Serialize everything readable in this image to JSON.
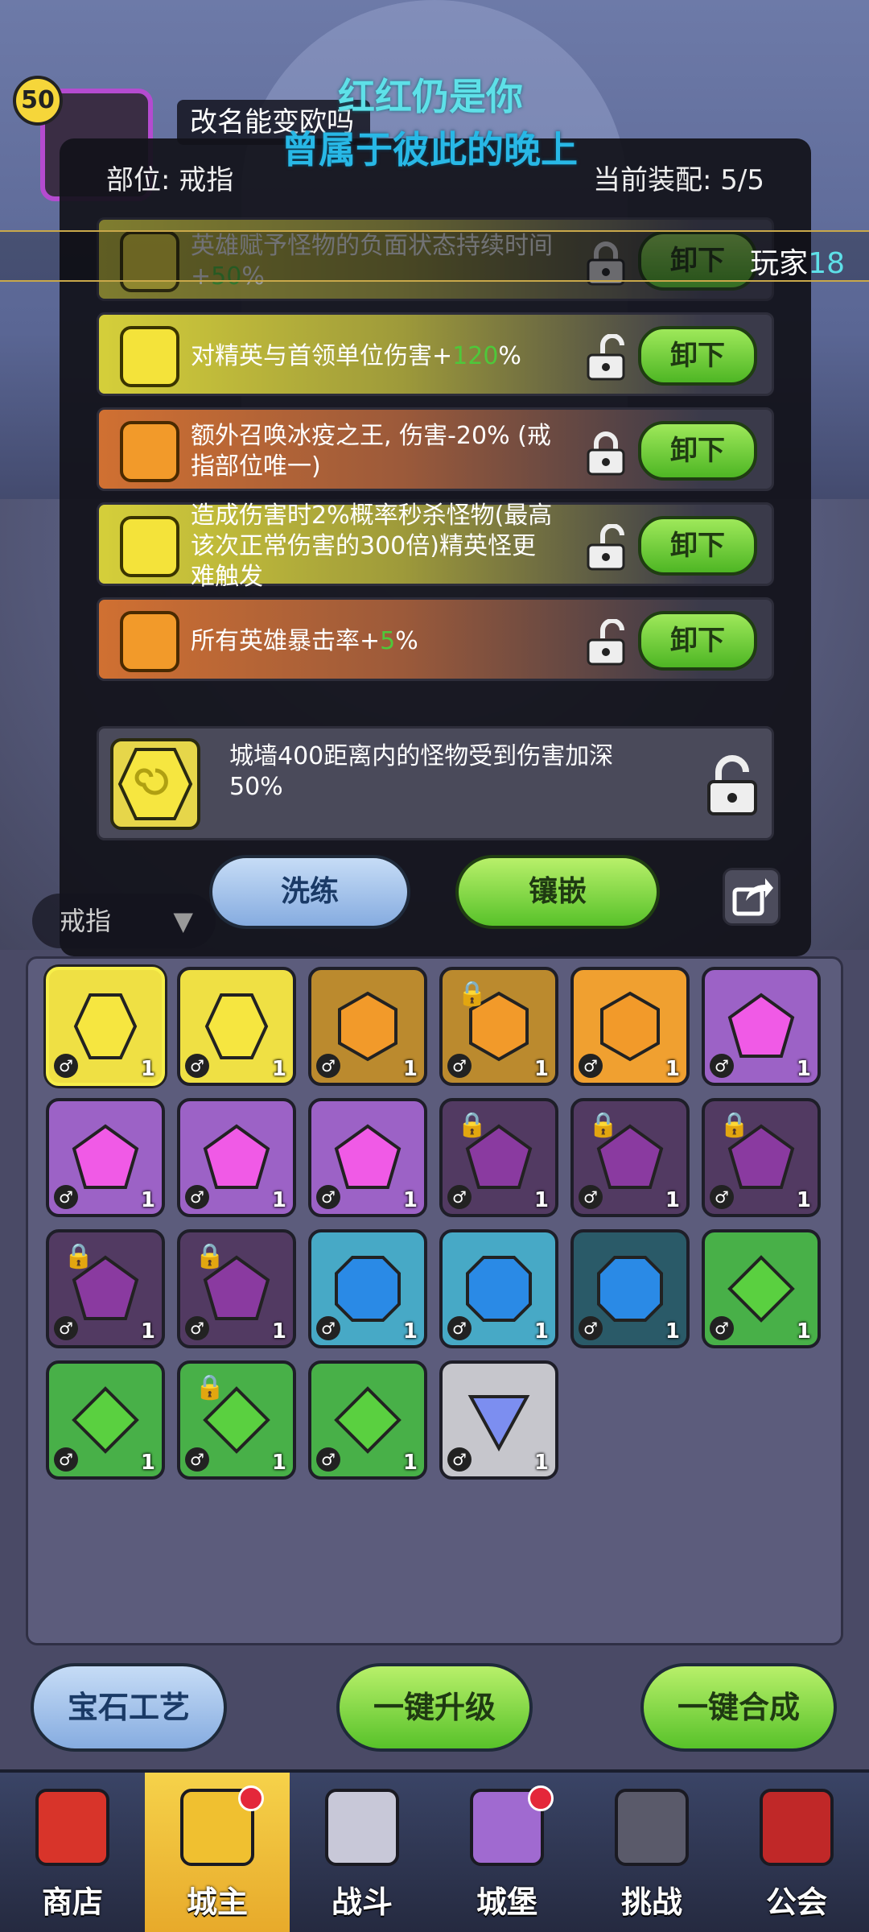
{
  "player": {
    "level": "50",
    "name": "改名能变欧吗"
  },
  "danmaku": [
    "红红仍是你",
    "曾属于彼此的晚上"
  ],
  "ticker": {
    "text": "玩家",
    "num": "18"
  },
  "panel": {
    "slot_label": "部位: 戒指",
    "equip_count": "当前装配: 5/5",
    "rows": [
      {
        "type": "yellow",
        "text_a": "英雄赋予怪物的负面状态持续时间+",
        "highlight": "50",
        "text_b": "%",
        "locked": true,
        "btn": "卸下"
      },
      {
        "type": "yellow",
        "text_a": "对精英与首领单位伤害+",
        "highlight": "120",
        "text_b": "%",
        "locked": false,
        "btn": "卸下"
      },
      {
        "type": "orange",
        "text_a": "额外召唤冰疫之王, 伤害-20% (戒指部位唯一)",
        "highlight": "",
        "text_b": "",
        "locked": true,
        "btn": "卸下"
      },
      {
        "type": "yellow",
        "text_a": "造成伤害时2%概率秒杀怪物(最高该次正常伤害的300倍)精英怪更难触发",
        "highlight": "",
        "text_b": "",
        "locked": false,
        "btn": "卸下"
      },
      {
        "type": "orange",
        "text_a": "所有英雄暴击率+",
        "highlight": "5",
        "text_b": "%",
        "locked": false,
        "btn": "卸下"
      }
    ],
    "extra_text": "城墙400距离内的怪物受到伤害加深50%",
    "refine_btn": "洗练",
    "inlay_btn": "镶嵌"
  },
  "filter": {
    "label": "戒指"
  },
  "inventory": [
    {
      "kind": "yellow-swirl",
      "color": "c-yellow sel",
      "count": "1",
      "locked": false
    },
    {
      "kind": "yellow-swirl",
      "color": "c-yellow",
      "count": "1",
      "locked": false
    },
    {
      "kind": "orange-hex",
      "color": "c-orange",
      "count": "1",
      "locked": false
    },
    {
      "kind": "orange-burst",
      "color": "c-orange",
      "count": "1",
      "locked": true
    },
    {
      "kind": "orange-swirl",
      "color": "c-orange2",
      "count": "1",
      "locked": false
    },
    {
      "kind": "pink-pentagon",
      "color": "c-purple",
      "count": "1",
      "locked": false
    },
    {
      "kind": "pink-pentagon",
      "color": "c-purple",
      "count": "1",
      "locked": false
    },
    {
      "kind": "pink-pentagon",
      "color": "c-purple",
      "count": "1",
      "locked": false
    },
    {
      "kind": "pink-swirl",
      "color": "c-purple",
      "count": "1",
      "locked": false
    },
    {
      "kind": "purple-burst",
      "color": "c-purple-dk",
      "count": "1",
      "locked": true
    },
    {
      "kind": "purple-burst",
      "color": "c-purple-dk",
      "count": "1",
      "locked": true
    },
    {
      "kind": "purple-burst",
      "color": "c-purple-dk",
      "count": "1",
      "locked": true
    },
    {
      "kind": "purple-burst",
      "color": "c-purple-dk",
      "count": "1",
      "locked": true
    },
    {
      "kind": "purple-burst",
      "color": "c-purple-dk",
      "count": "1",
      "locked": true
    },
    {
      "kind": "blue-swirl",
      "color": "c-blue",
      "count": "1",
      "locked": false
    },
    {
      "kind": "blue-swirl",
      "color": "c-blue",
      "count": "1",
      "locked": false
    },
    {
      "kind": "blue-octagon",
      "color": "c-blue-dk",
      "count": "1",
      "locked": false
    },
    {
      "kind": "green-diamond",
      "color": "c-green",
      "count": "1",
      "locked": false
    },
    {
      "kind": "green-swirl",
      "color": "c-green",
      "count": "1",
      "locked": false
    },
    {
      "kind": "green-diamond",
      "color": "c-green",
      "count": "1",
      "locked": true
    },
    {
      "kind": "green-swirl",
      "color": "c-green",
      "count": "1",
      "locked": false
    },
    {
      "kind": "blue-triangle",
      "color": "c-gray",
      "count": "1",
      "locked": false
    }
  ],
  "bottom_buttons": [
    "宝石工艺",
    "一键升级",
    "一键合成"
  ],
  "nav": [
    {
      "label": "商店",
      "icon": "shop-icon",
      "active": false,
      "dot": false
    },
    {
      "label": "城主",
      "icon": "crown-icon",
      "active": true,
      "dot": true
    },
    {
      "label": "战斗",
      "icon": "swords-icon",
      "active": false,
      "dot": false
    },
    {
      "label": "城堡",
      "icon": "castle-icon",
      "active": false,
      "dot": true
    },
    {
      "label": "挑战",
      "icon": "demon-icon",
      "active": false,
      "dot": false
    },
    {
      "label": "公会",
      "icon": "guild-banner-icon",
      "active": false,
      "dot": false
    }
  ]
}
